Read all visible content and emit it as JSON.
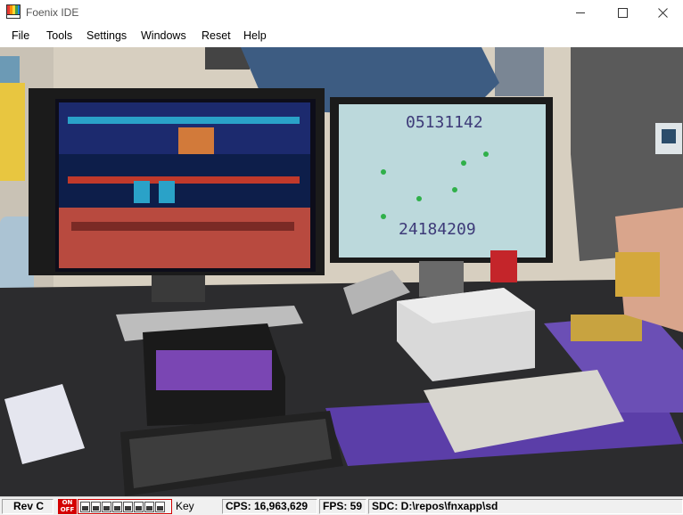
{
  "window": {
    "title": "Foenix IDE",
    "minimize_glyph": "—",
    "maximize_glyph": "☐",
    "close_glyph": "✕"
  },
  "menu": {
    "items": [
      "File",
      "Tools",
      "Settings",
      "Windows",
      "Reset",
      "Help"
    ]
  },
  "screen": {
    "left_monitor_score": "",
    "right_monitor_top": "05131142",
    "right_monitor_bottom": "24184209"
  },
  "status": {
    "revision": "Rev C",
    "switch_on": "ON",
    "switch_off": "OFF",
    "led_count": 8,
    "key_label": "Key",
    "cps": "CPS: 16,963,629",
    "fps": "FPS: 59",
    "sdc": "SDC: D:\\repos\\fnxapp\\sd"
  },
  "colors": {
    "onoff_red": "#d40000",
    "statusbar_bg": "#f0f0f0"
  }
}
